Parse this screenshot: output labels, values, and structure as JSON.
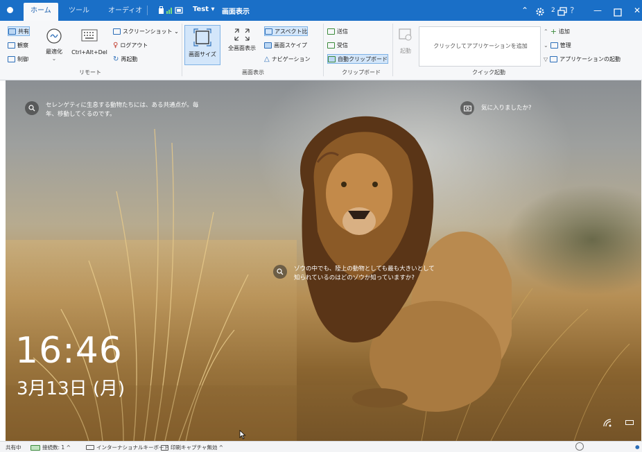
{
  "titlebar": {
    "tabs": [
      {
        "label": "ホーム",
        "active": true
      },
      {
        "label": "ツール",
        "active": false
      },
      {
        "label": "オーディオ",
        "active": false
      }
    ],
    "session_name": "Test ▾",
    "page_title": "画面表示",
    "sessions_count": "2",
    "help": "?",
    "accent": "#1a6fc7"
  },
  "ribbon": {
    "remote": {
      "label": "リモート",
      "share": "共有",
      "observe": "観察",
      "control": "制御",
      "optimize": "最適化",
      "ctrl_alt_del": "Ctrl+Alt+Del",
      "screenshot": "スクリーンショット ⌄",
      "logout": "ログアウト",
      "restart": "再起動"
    },
    "display": {
      "label": "画面表示",
      "screen_size": "画面サイズ",
      "fullscreen": "全画面表示",
      "aspect": "アスペクト比",
      "scale": "画面スケイプ",
      "navigation": "ナビゲーション"
    },
    "clipboard": {
      "label": "クリップボード",
      "send": "送信",
      "receive": "受信",
      "auto": "自動クリップボード"
    },
    "quick": {
      "label": "クイック起動",
      "launch": "起動",
      "hint": "クリックしてアプリケーションを追加",
      "add": "追加",
      "manage": "管理",
      "app_launch": "アプリケーションの起動"
    }
  },
  "screen": {
    "tip1": "セレンゲティに生息する動物たちには、ある共通点が。毎年、移動してくるのです。",
    "tip2": "気に入りましたか?",
    "tip3": "ゾウの中でも、陸上の動物としても最も大きいとして知られているのはどのゾウか知っていますか?",
    "time": "16:46",
    "date": "3月13日 (月)"
  },
  "statusbar": {
    "status": "共有中",
    "connections": "接続数: 1 ^",
    "keyboard": "インターナショナルキーボード",
    "print": "印刷キャプチャ無効 ^"
  }
}
